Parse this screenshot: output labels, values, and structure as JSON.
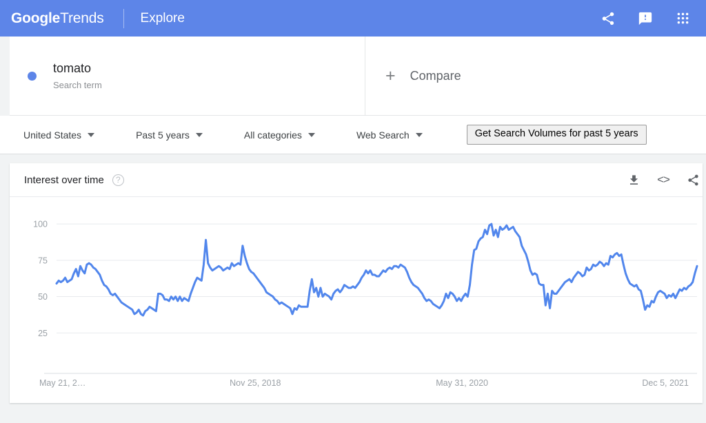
{
  "header": {
    "brand_bold": "Google",
    "brand_light": "Trends",
    "nav_label": "Explore",
    "icons": [
      {
        "name": "share-icon",
        "label": "Share"
      },
      {
        "name": "feedback-icon",
        "label": "Send feedback"
      },
      {
        "name": "apps-grid-icon",
        "label": "Google apps"
      }
    ]
  },
  "query": {
    "term": "tomato",
    "type_label": "Search term",
    "dot_color": "#5d85e8",
    "compare_plus": "+",
    "compare_label": "Compare"
  },
  "filters": [
    {
      "name": "location",
      "label": "United States"
    },
    {
      "name": "time-range",
      "label": "Past 5 years"
    },
    {
      "name": "category",
      "label": "All categories"
    },
    {
      "name": "search-type",
      "label": "Web Search"
    }
  ],
  "extension_button": {
    "label": "Get Search Volumes for past 5 years"
  },
  "chart_panel": {
    "title": "Interest over time",
    "help_glyph": "?",
    "actions": [
      {
        "name": "download-icon",
        "label": "Download CSV"
      },
      {
        "name": "embed-icon",
        "label": "Embed",
        "glyph": "<>"
      },
      {
        "name": "share-icon",
        "label": "Share"
      }
    ]
  },
  "chart_data": {
    "type": "line",
    "title": "Interest over time",
    "xlabel": "",
    "ylabel": "",
    "ylim": [
      0,
      110
    ],
    "yticks": [
      25,
      50,
      75,
      100
    ],
    "ytick_labels": [
      "25",
      "50",
      "75",
      "100"
    ],
    "grid": true,
    "legend": false,
    "series_name": "tomato",
    "series_color": "#5186ec",
    "line_width": 3,
    "xtick_labels": [
      "May 21, 2…",
      "Nov 25, 2018",
      "May 31, 2020",
      "Dec 5, 2021"
    ],
    "xtick_positions": [
      0,
      0.322,
      0.644,
      0.966
    ],
    "x_range_note": "Weekly points, May 2017 – May 2022 (261 weeks)",
    "values": [
      59,
      61,
      60,
      61,
      63,
      60,
      61,
      62,
      66,
      69,
      64,
      71,
      68,
      66,
      72,
      73,
      72,
      70,
      69,
      67,
      65,
      61,
      58,
      57,
      55,
      52,
      51,
      52,
      50,
      48,
      46,
      45,
      44,
      43,
      42,
      41,
      38,
      39,
      41,
      38,
      37,
      40,
      41,
      43,
      42,
      41,
      40,
      52,
      52,
      51,
      48,
      48,
      47,
      50,
      48,
      50,
      47,
      50,
      47,
      49,
      48,
      47,
      52,
      56,
      60,
      63,
      62,
      61,
      72,
      89,
      73,
      70,
      68,
      69,
      70,
      71,
      70,
      68,
      69,
      70,
      69,
      73,
      71,
      72,
      73,
      72,
      85,
      78,
      73,
      69,
      67,
      66,
      64,
      62,
      60,
      58,
      56,
      53,
      52,
      51,
      50,
      48,
      47,
      45,
      46,
      45,
      44,
      43,
      42,
      38,
      42,
      41,
      44,
      43,
      43,
      43,
      43,
      54,
      62,
      53,
      56,
      50,
      56,
      50,
      52,
      51,
      50,
      48,
      52,
      54,
      55,
      53,
      55,
      58,
      57,
      56,
      56,
      57,
      56,
      58,
      60,
      63,
      65,
      68,
      66,
      68,
      65,
      65,
      64,
      64,
      66,
      68,
      67,
      69,
      70,
      69,
      71,
      71,
      70,
      72,
      71,
      70,
      67,
      63,
      60,
      58,
      57,
      56,
      54,
      52,
      49,
      47,
      48,
      47,
      45,
      44,
      43,
      42,
      44,
      47,
      52,
      49,
      53,
      52,
      50,
      47,
      49,
      47,
      50,
      52,
      50,
      58,
      72,
      82,
      83,
      88,
      90,
      91,
      96,
      93,
      99,
      100,
      92,
      96,
      91,
      98,
      96,
      97,
      99,
      96,
      97,
      98,
      95,
      93,
      91,
      85,
      82,
      79,
      74,
      68,
      65,
      66,
      65,
      59,
      58,
      58,
      44,
      52,
      42,
      54,
      52,
      52,
      54,
      56,
      58,
      60,
      61,
      62,
      60,
      63,
      65,
      67,
      66,
      64,
      65,
      70,
      68,
      69,
      72,
      71,
      72,
      74,
      73,
      71,
      73,
      72,
      78,
      77,
      79,
      80,
      78,
      79,
      72,
      66,
      62,
      59,
      58,
      57,
      58,
      55,
      54,
      48,
      41,
      44,
      43,
      47,
      46,
      50,
      53,
      54,
      53,
      52,
      49,
      51,
      50,
      52,
      49,
      52,
      55,
      54,
      56,
      55,
      57,
      58,
      60,
      66,
      71
    ]
  }
}
